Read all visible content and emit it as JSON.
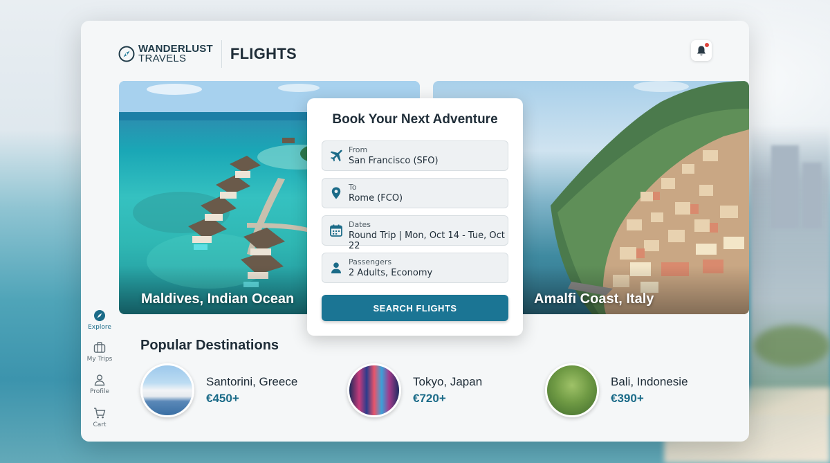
{
  "header": {
    "brand_line1": "WANDERLUST",
    "brand_line2": "TRAVELS",
    "page_title": "FLIGHTS"
  },
  "heroes": [
    {
      "label": "Maldives, Indian Ocean"
    },
    {
      "label": "Amalfi Coast, Italy"
    }
  ],
  "booking": {
    "title": "Book Your Next Adventure",
    "fields": [
      {
        "label": "From",
        "value": "San Francisco (SFO)",
        "icon": "airplane-icon"
      },
      {
        "label": "To",
        "value": "Rome (FCO)",
        "icon": "location-pin-icon"
      },
      {
        "label": "Dates",
        "value": "Round Trip | Mon, Oct 14 - Tue, Oct 22",
        "icon": "calendar-icon"
      },
      {
        "label": "Passengers",
        "value": "2 Adults, Economy",
        "icon": "person-icon"
      }
    ],
    "search_label": "SEARCH FLIGHTS"
  },
  "nav": [
    {
      "label": "Explore",
      "icon": "compass-icon",
      "active": true
    },
    {
      "label": "My Trips",
      "icon": "suitcase-icon"
    },
    {
      "label": "Profile",
      "icon": "person-icon"
    },
    {
      "label": "Cart",
      "icon": "cart-icon"
    }
  ],
  "popular": {
    "title": "Popular Destinations",
    "items": [
      {
        "name": "Santorini, Greece",
        "price": "€450+"
      },
      {
        "name": "Tokyo, Japan",
        "price": "€720+"
      },
      {
        "name": "Bali, Indonesie",
        "price": "€390+"
      }
    ]
  },
  "colors": {
    "accent": "#1b7594",
    "price": "#1b6b88",
    "notification_dot": "#e0453d"
  }
}
